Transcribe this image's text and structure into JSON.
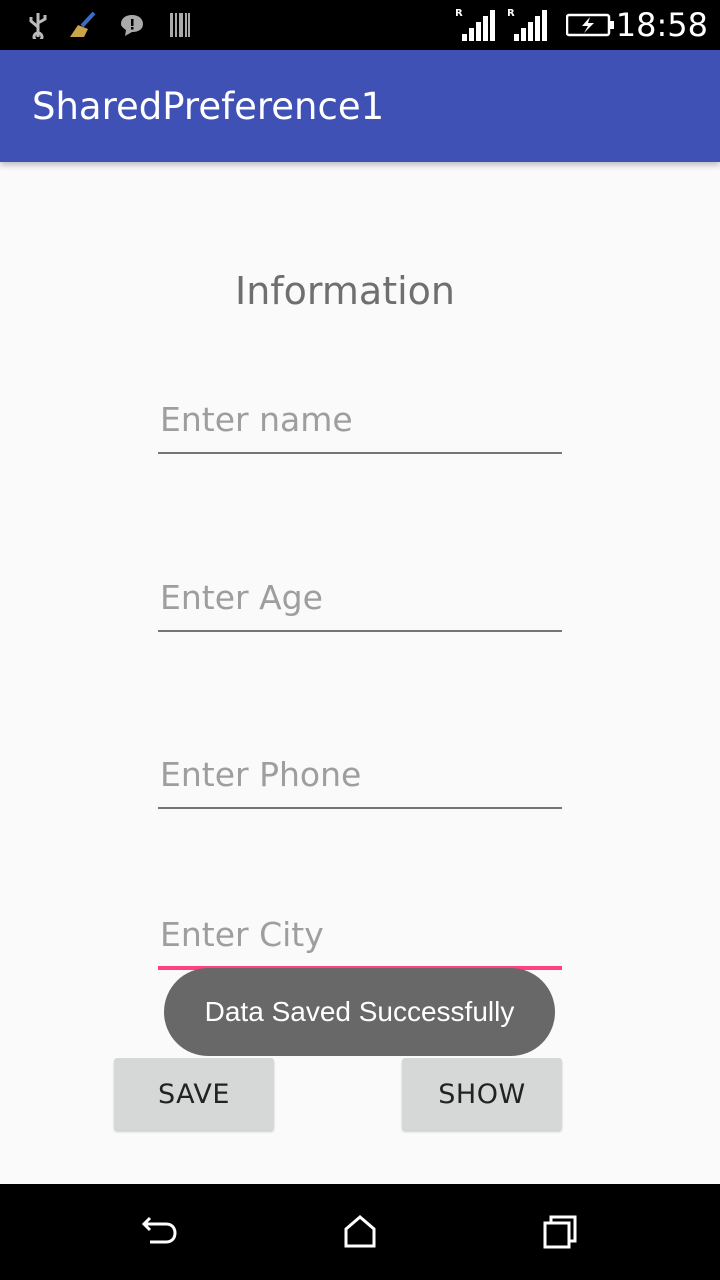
{
  "status_bar": {
    "time": "18:58",
    "icons": [
      "usb-icon",
      "broom-icon",
      "chat-icon",
      "barcode-icon",
      "signal-icon",
      "signal-icon",
      "battery-charging-icon"
    ],
    "roaming_label": "R"
  },
  "app_bar": {
    "title": "SharedPreference1",
    "color": "#3f51b5"
  },
  "form": {
    "heading": "Information",
    "fields": [
      {
        "placeholder": "Enter name",
        "value": ""
      },
      {
        "placeholder": "Enter Age",
        "value": ""
      },
      {
        "placeholder": "Enter Phone",
        "value": ""
      },
      {
        "placeholder": "Enter City",
        "value": "",
        "focused": true
      }
    ],
    "accent_color": "#ff4081"
  },
  "buttons": {
    "save": "SAVE",
    "show": "SHOW"
  },
  "toast": {
    "message": "Data Saved Successfully"
  },
  "nav_bar": {
    "icons": [
      "back-icon",
      "home-icon",
      "recents-icon"
    ]
  }
}
